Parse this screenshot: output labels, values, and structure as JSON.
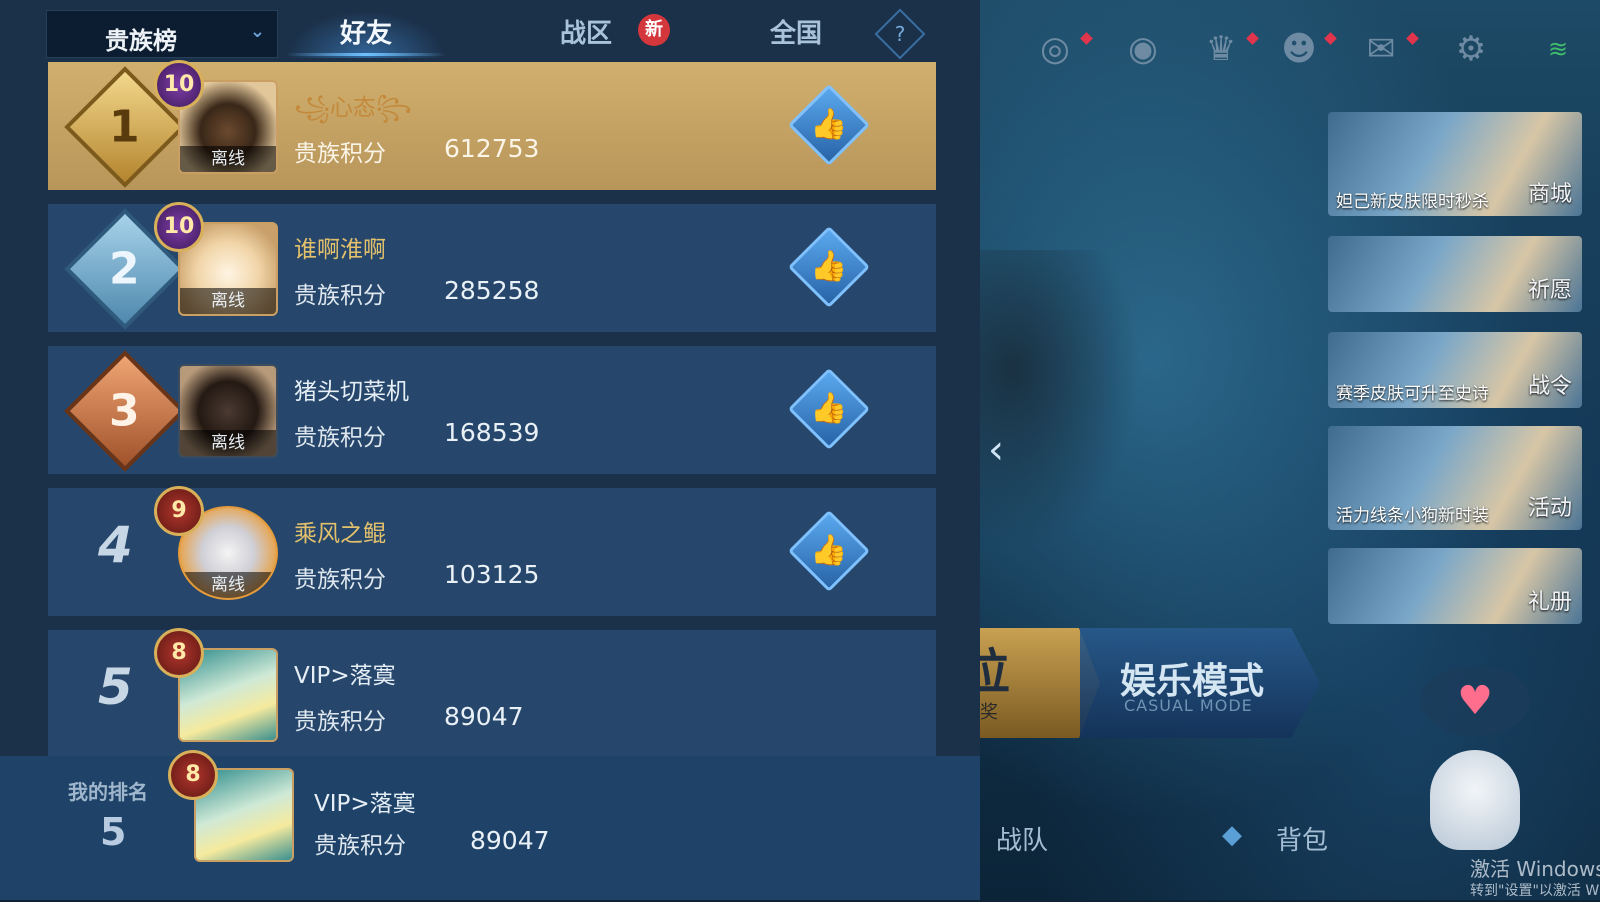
{
  "header": {
    "dropdown_label": "贵族榜",
    "tabs": [
      {
        "label": "好友",
        "active": true
      },
      {
        "label": "战区",
        "badge": "新"
      },
      {
        "label": "全国"
      }
    ],
    "help": "?"
  },
  "ranking": [
    {
      "rank": "1",
      "name": "꧁心态꧂",
      "vip": "10",
      "status": "离线",
      "score_label": "贵族积分",
      "score": "612753"
    },
    {
      "rank": "2",
      "name": "谁啊淮啊",
      "vip": "10",
      "status": "离线",
      "score_label": "贵族积分",
      "score": "285258"
    },
    {
      "rank": "3",
      "name": "猪头切菜机",
      "vip": "",
      "status": "离线",
      "score_label": "贵族积分",
      "score": "168539"
    },
    {
      "rank": "4",
      "name": "乘风之鲲",
      "vip": "9",
      "status": "离线",
      "score_label": "贵族积分",
      "score": "103125"
    },
    {
      "rank": "5",
      "name": "VIP>落寞",
      "vip": "8",
      "status": "",
      "score_label": "贵族积分",
      "score": "89047"
    }
  ],
  "my_rank": {
    "label": "我的排名",
    "rank": "5",
    "name": "VIP>落寞",
    "vip": "8",
    "score_label": "贵族积分",
    "score": "89047"
  },
  "lobby": {
    "side_cards": [
      {
        "caption": "妲己新皮肤限时秒杀",
        "label": "商城"
      },
      {
        "caption": "",
        "label": "祈愿"
      },
      {
        "caption": "赛季皮肤可升至史诗",
        "label": "战令"
      },
      {
        "caption": "活力线条小狗新时装",
        "label": "活动"
      },
      {
        "caption": "",
        "label": "礼册"
      }
    ],
    "mode_left_big": "位",
    "mode_left_small": "有奖",
    "mode_casual": "娱乐模式",
    "mode_casual_en": "CASUAL MODE",
    "bottom_links": [
      "战队",
      "背包"
    ],
    "watermark_line1": "激活 Windows",
    "watermark_line2": "转到\"设置\"以激活 W"
  },
  "colors": {
    "panel": "#1b3049",
    "row": "#26476b",
    "first_row": "#c8a465",
    "accent": "#6fc2ff",
    "badge_red": "#d3373b"
  }
}
